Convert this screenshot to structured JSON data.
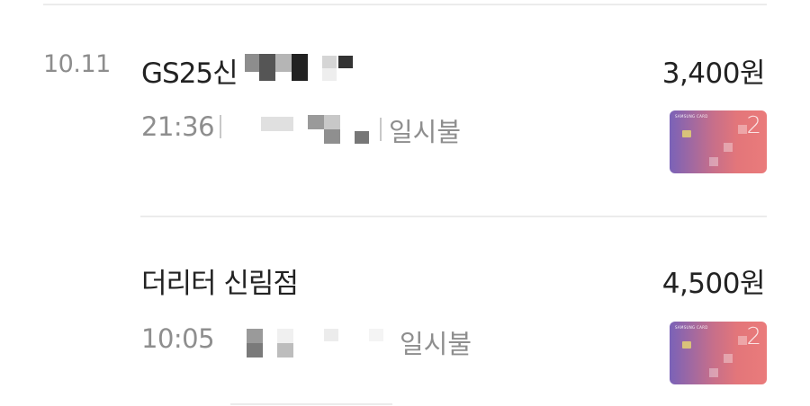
{
  "transactions": [
    {
      "date": "10.11",
      "merchant_name": "GS25신",
      "amount": "3,400원",
      "time": "21:36",
      "installment": "일시불",
      "card_label": "SAMSUNG CARD",
      "card_number": "2"
    },
    {
      "merchant_name": "더리터 신림점",
      "amount": "4,500원",
      "time": "10:05",
      "installment": "일시불",
      "card_label": "SAMSUNG CARD",
      "card_number": "2"
    }
  ]
}
